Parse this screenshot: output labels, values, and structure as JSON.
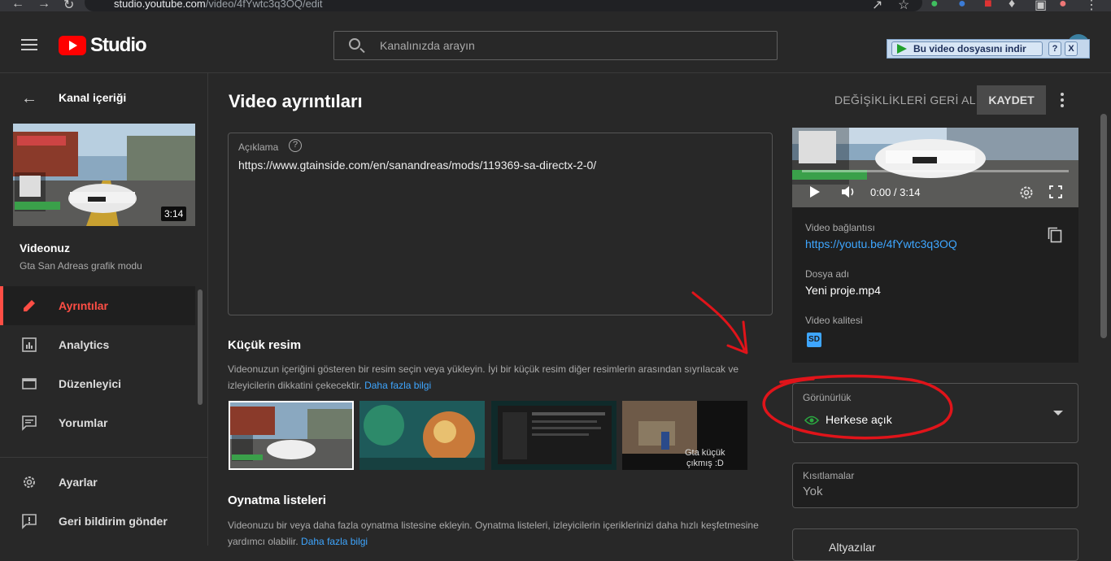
{
  "browser": {
    "url_host": "studio.youtube.com",
    "url_path": "/video/4fYwtc3q3OQ/edit"
  },
  "header": {
    "logo_text": "Studio",
    "search_placeholder": "Kanalınızda arayın"
  },
  "download_bar": {
    "button_label": "Bu video dosyasını indir",
    "help_label": "?",
    "close_label": "X"
  },
  "sidebar": {
    "back_label": "Kanal içeriği",
    "thumbnail_duration": "3:14",
    "your_video_label": "Videonuz",
    "video_title": "Gta San Adreas grafik modu",
    "items": [
      {
        "label": "Ayrıntılar",
        "icon": "pencil-icon",
        "active": true
      },
      {
        "label": "Analytics",
        "icon": "analytics-icon",
        "active": false
      },
      {
        "label": "Düzenleyici",
        "icon": "editor-icon",
        "active": false
      },
      {
        "label": "Yorumlar",
        "icon": "comments-icon",
        "active": false
      }
    ],
    "bottom_items": [
      {
        "label": "Ayarlar",
        "icon": "gear-icon"
      },
      {
        "label": "Geri bildirim gönder",
        "icon": "feedback-icon"
      }
    ]
  },
  "main": {
    "title": "Video ayrıntıları",
    "undo_label": "DEĞİŞİKLİKLERİ GERİ AL",
    "save_label": "KAYDET",
    "description": {
      "label": "Açıklama",
      "help": "?",
      "value": "https://www.gtainside.com/en/sanandreas/mods/119369-sa-directx-2-0/"
    },
    "thumbnail": {
      "heading": "Küçük resim",
      "description": "Videonuzun içeriğini gösteren bir resim seçin veya yükleyin. İyi bir küçük resim diğer resimlerin arasından sıyrılacak ve izleyicilerin dikkatini çekecektir.",
      "link": "Daha fazla bilgi",
      "overlay_text_1": "Gta küçük",
      "overlay_text_2": "çıkmış :D"
    },
    "playlists": {
      "heading": "Oynatma listeleri",
      "description": "Videonuzu bir veya daha fazla oynatma listesine ekleyin. Oynatma listeleri, izleyicilerin içeriklerinizi daha hızlı keşfetmesine yardımcı olabilir.",
      "link": "Daha fazla bilgi"
    }
  },
  "panel": {
    "timecode": "0:00 / 3:14",
    "link_label": "Video bağlantısı",
    "link_value": "https://youtu.be/4fYwtc3q3OQ",
    "file_label": "Dosya adı",
    "file_value": "Yeni proje.mp4",
    "quality_label": "Video kalitesi",
    "quality_badge": "SD",
    "visibility_label": "Görünürlük",
    "visibility_value": "Herkese açık",
    "restrictions_label": "Kısıtlamalar",
    "restrictions_value": "Yok",
    "last_label": "Altyazılar"
  },
  "colors": {
    "accent_red": "#ff4e45",
    "link_blue": "#3ea6ff",
    "annotation_red": "#e0141a"
  }
}
